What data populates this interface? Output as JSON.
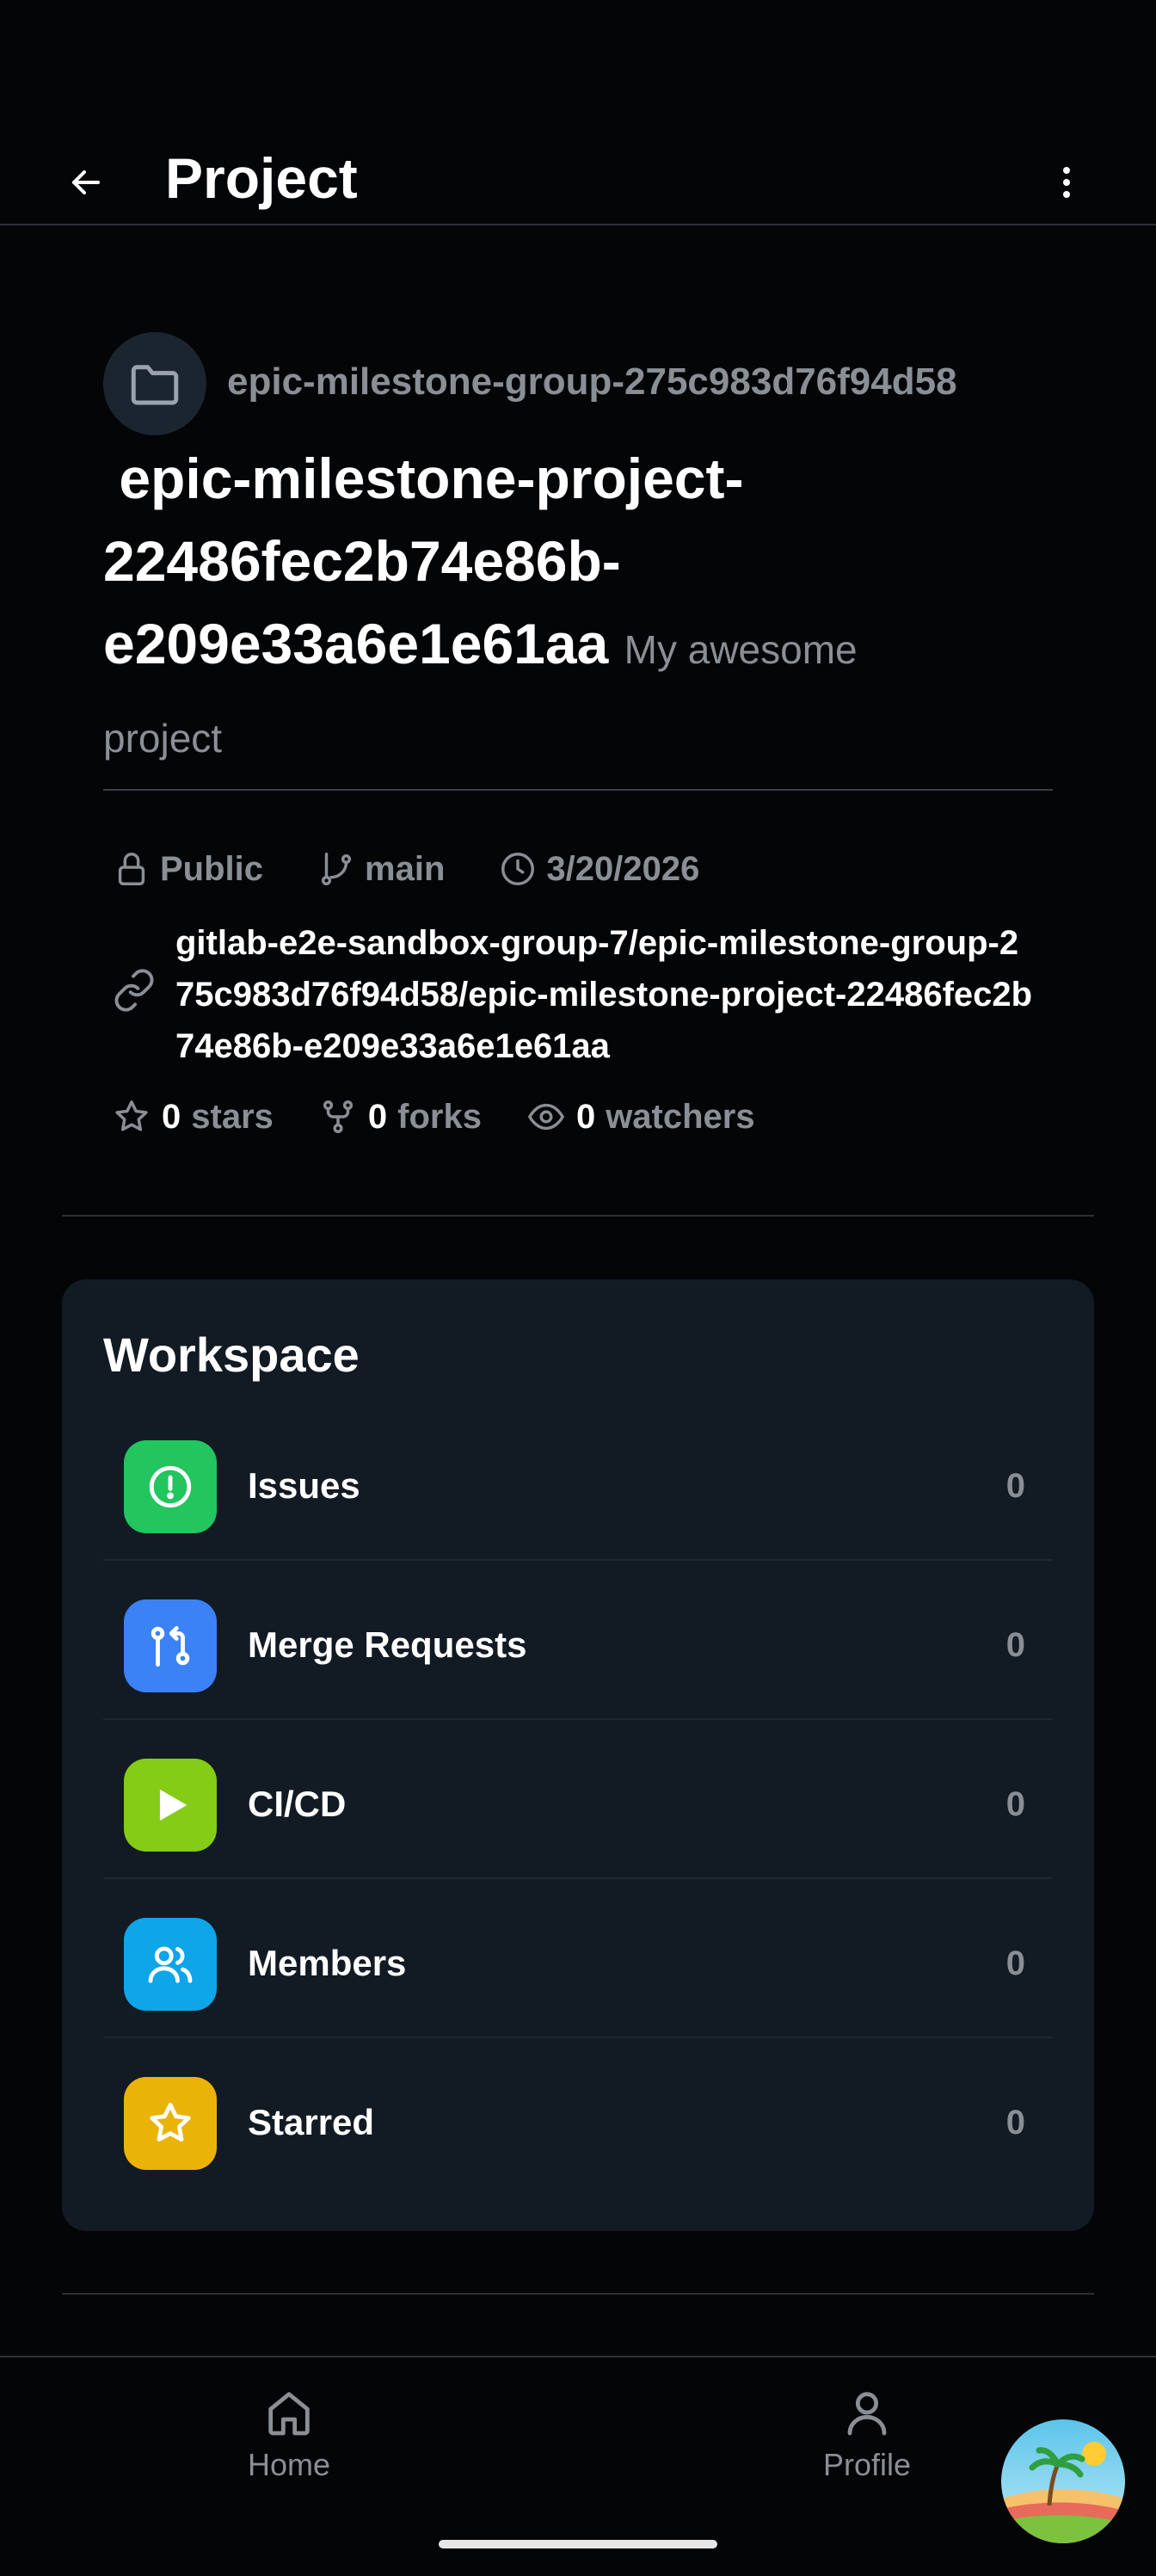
{
  "app_bar": {
    "title": "Project"
  },
  "project": {
    "group_name": "epic-milestone-group-275c983d76f94d58",
    "name": "epic-milestone-project-22486fec2b74e86b-e209e33a6e1e61aa",
    "description": "My awesome project",
    "visibility": "Public",
    "branch": "main",
    "date": "3/20/2026",
    "path": "gitlab-e2e-sandbox-group-7/epic-milestone-group-275c983d76f94d58/epic-milestone-project-22486fec2b74e86b-e209e33a6e1e61aa",
    "stats": {
      "stars_count": "0",
      "stars_label": "stars",
      "forks_count": "0",
      "forks_label": "forks",
      "watchers_count": "0",
      "watchers_label": "watchers"
    }
  },
  "workspace": {
    "title": "Workspace",
    "items": [
      {
        "label": "Issues",
        "count": "0",
        "icon": "alert-circle-icon",
        "color": "#22c55e"
      },
      {
        "label": "Merge Requests",
        "count": "0",
        "icon": "git-pull-request-icon",
        "color": "#3b82f6"
      },
      {
        "label": "CI/CD",
        "count": "0",
        "icon": "play-icon",
        "color": "#84cc16"
      },
      {
        "label": "Members",
        "count": "0",
        "icon": "users-icon",
        "color": "#0ea5e9"
      },
      {
        "label": "Starred",
        "count": "0",
        "icon": "star-icon",
        "color": "#eab308"
      }
    ]
  },
  "bottom_nav": {
    "home_label": "Home",
    "profile_label": "Profile"
  },
  "colors": {
    "background": "#030507",
    "card": "#121a24",
    "muted_text": "#8a8f96"
  }
}
